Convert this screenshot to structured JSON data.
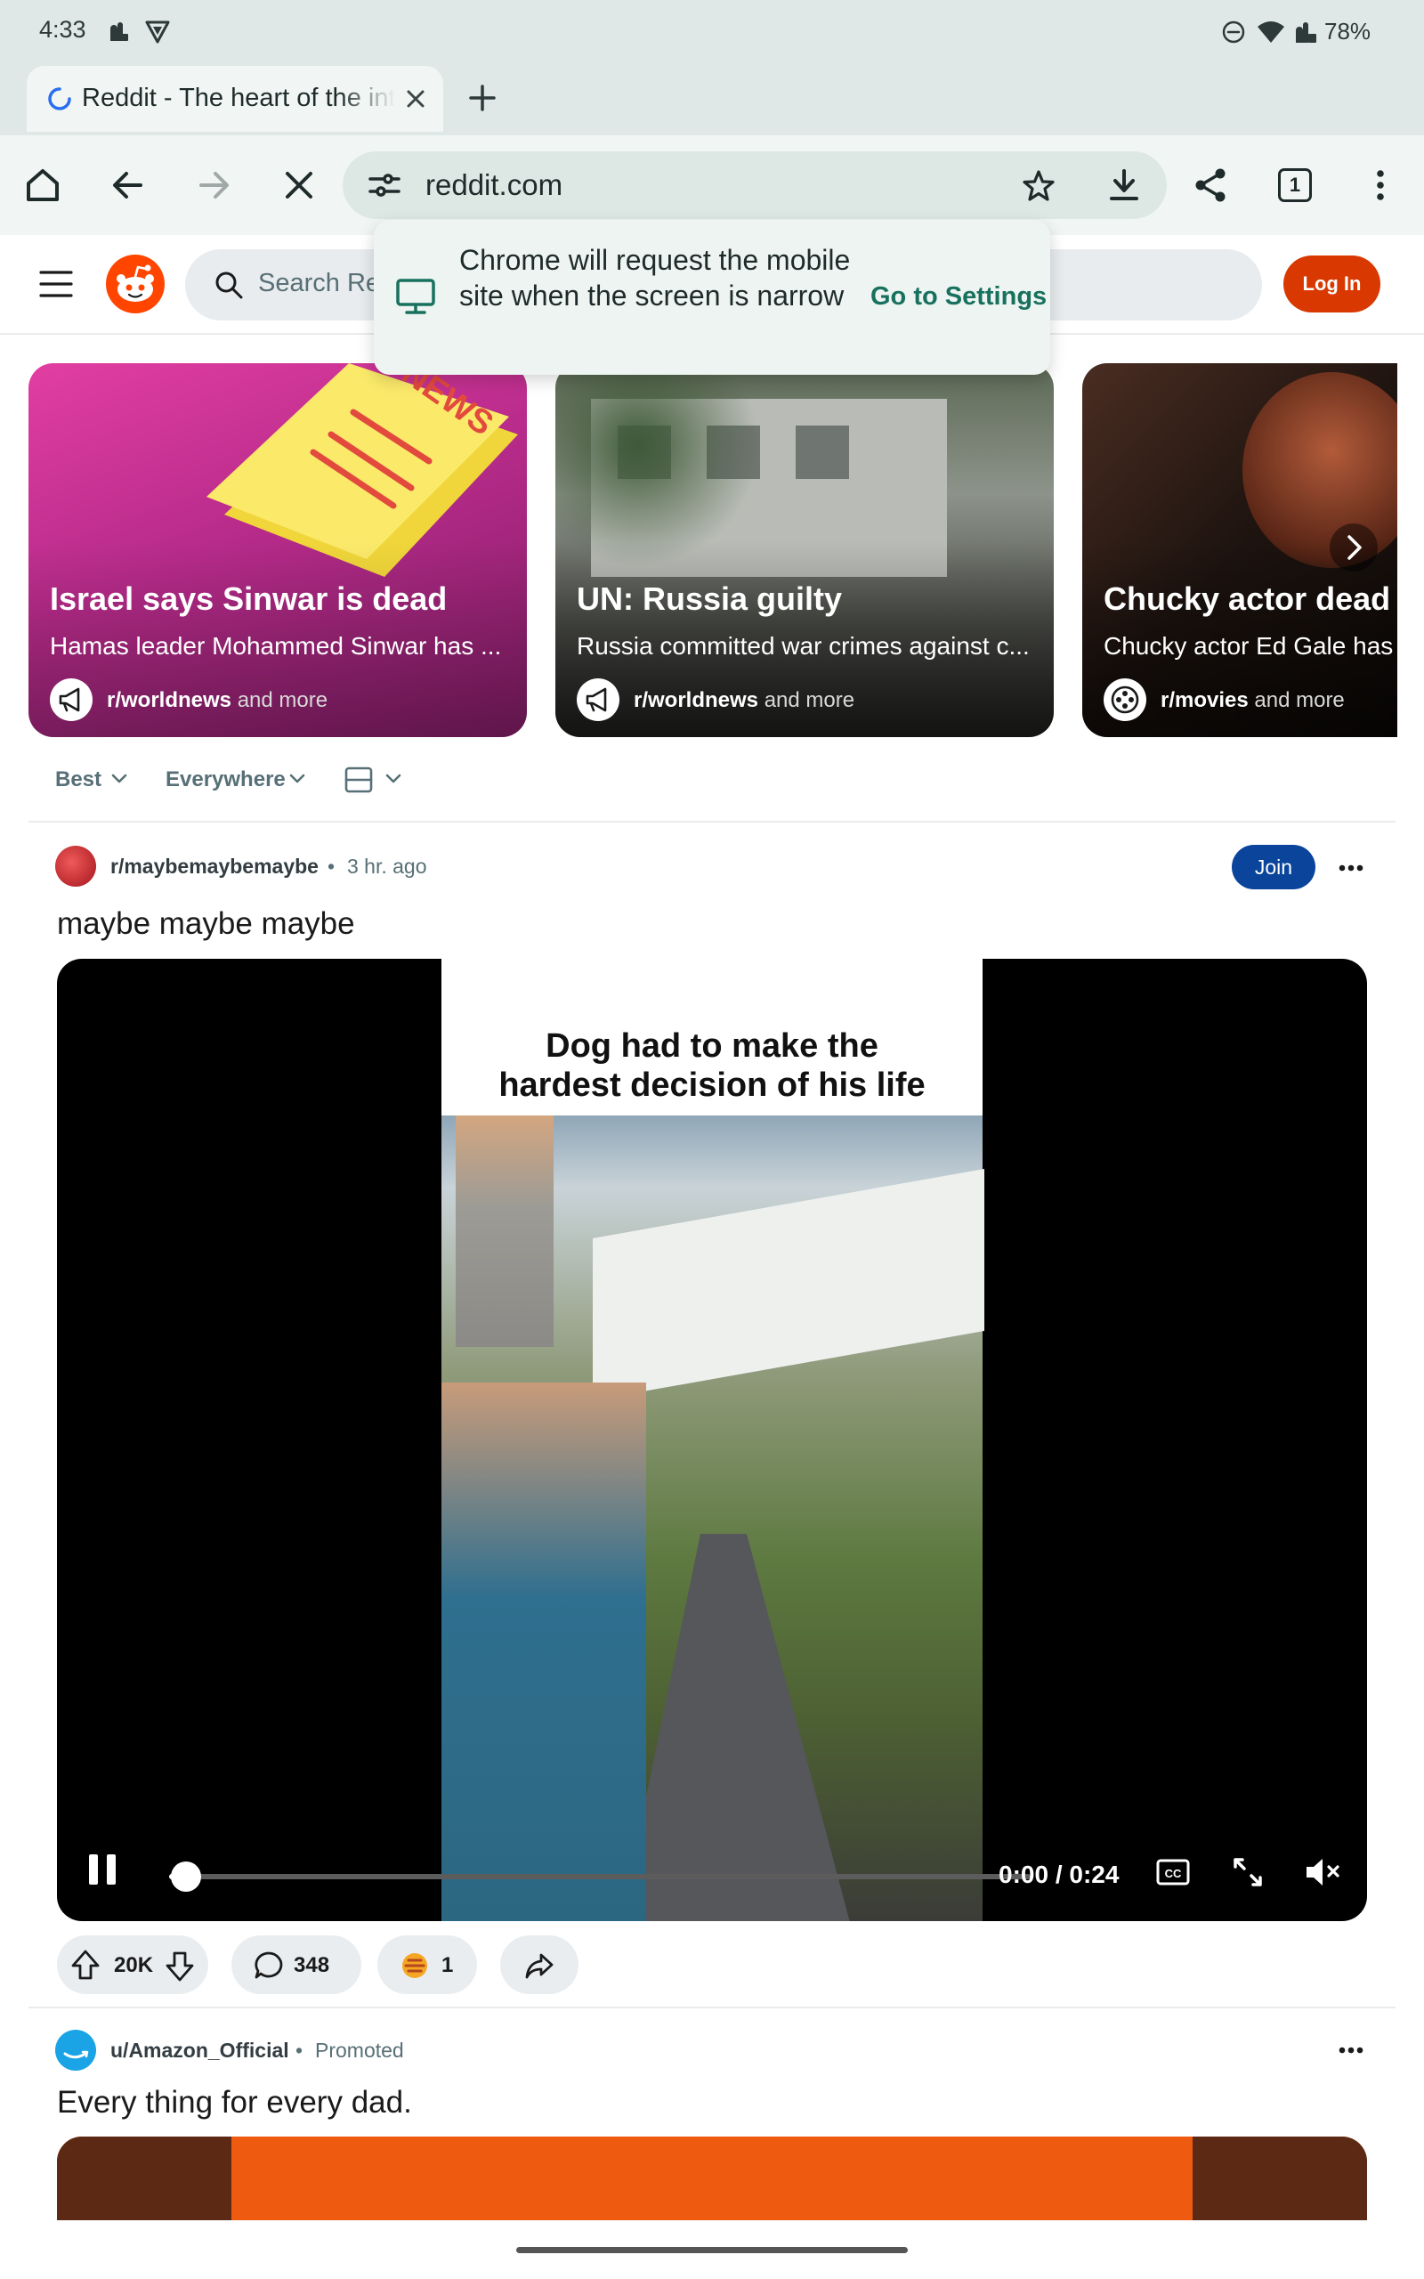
{
  "status_bar": {
    "time": "4:33",
    "battery": "78%"
  },
  "tab": {
    "title": "Reddit - The heart of the internet"
  },
  "toolbar": {
    "url": "reddit.com",
    "tab_count": "1"
  },
  "reddit_header": {
    "search_placeholder": "Search Reddit",
    "login_label": "Log In"
  },
  "popup": {
    "message": "Chrome will request the mobile site when the screen is narrow",
    "link_label": "Go to Settings"
  },
  "trending": [
    {
      "title": "Israel says Sinwar is dead",
      "subtitle": "Hamas leader Mohammed Sinwar has ...",
      "subreddit": "r/worldnews",
      "more": "and more"
    },
    {
      "title": "UN: Russia guilty",
      "subtitle": "Russia committed war crimes against c...",
      "subreddit": "r/worldnews",
      "more": "and more"
    },
    {
      "title": "Chucky actor dead a",
      "subtitle": "Chucky actor Ed Gale has d",
      "subreddit": "r/movies",
      "more": "and more"
    }
  ],
  "filters": {
    "sort": "Best",
    "location": "Everywhere"
  },
  "post": {
    "subreddit": "r/maybemaybemaybe",
    "dot": "•",
    "time": "3 hr. ago",
    "join_label": "Join",
    "title": "maybe maybe maybe",
    "video_caption_line1": "Dog had to make the",
    "video_caption_line2": "hardest decision of his life",
    "video_time": "0:00 / 0:24",
    "video_progress": 0.02,
    "votes": "20K",
    "comments": "348",
    "awards": "1"
  },
  "promoted": {
    "user": "u/Amazon_Official",
    "dot": "•",
    "label": "Promoted",
    "title": "Every thing for every dad."
  },
  "colors": {
    "reddit_orange": "#ff4500",
    "login": "#d93900",
    "join": "#0a449b",
    "chrome_bg": "#dfe8e6",
    "settings_link": "#18715e"
  }
}
